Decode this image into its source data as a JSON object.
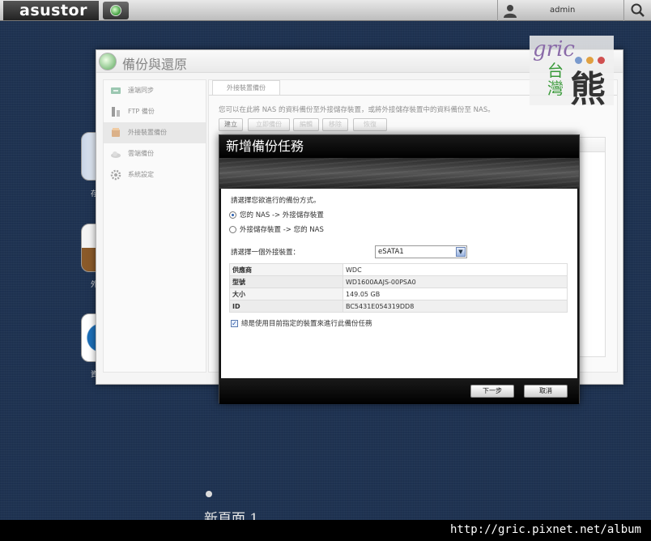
{
  "topbar": {
    "brand": "asustor",
    "user": "admin"
  },
  "window": {
    "title": "備份與還原",
    "sidebar": [
      {
        "label": "遠端同步",
        "icon": "remote-sync-icon"
      },
      {
        "label": "FTP 備份",
        "icon": "ftp-icon"
      },
      {
        "label": "外接裝置備份",
        "icon": "external-device-icon",
        "active": true
      },
      {
        "label": "雲端備份",
        "icon": "cloud-icon"
      },
      {
        "label": "系統設定",
        "icon": "gear-icon"
      }
    ],
    "tab": "外接裝置備份",
    "description": "您可以在此將 NAS 的資料備份至外接儲存裝置，或將外接儲存裝置中的資料備份至 NAS。",
    "toolbar": [
      "建立",
      "立即備份",
      "編輯",
      "移除",
      "恢復"
    ]
  },
  "watermark": {
    "script": "gric",
    "tw": "台灣",
    "bear": "熊"
  },
  "dialog": {
    "title": "新增備份任務",
    "question": "請選擇您欲進行的備份方式。",
    "options": [
      "您的 NAS -> 外接儲存裝置",
      "外接儲存裝置 -> 您的 NAS"
    ],
    "selected_option": 0,
    "device_label": "請選擇一個外接裝置：",
    "device_value": "eSATA1",
    "info": [
      {
        "key": "供應商",
        "value": "WDC"
      },
      {
        "key": "型號",
        "value": "WD1600AAJS-00PSA0"
      },
      {
        "key": "大小",
        "value": "149.05 GB"
      },
      {
        "key": "ID",
        "value": "BC5431E054319DD8"
      }
    ],
    "checkbox_label": "總是使用目前指定的裝置來進行此備份任務",
    "checkbox_checked": true,
    "next_label": "下一步",
    "cancel_label": "取消"
  },
  "desktop": {
    "page_label": "新頁面 1",
    "icon_labels": [
      "存",
      "外",
      "資"
    ]
  },
  "footer": {
    "url": "http://gric.pixnet.net/album"
  }
}
